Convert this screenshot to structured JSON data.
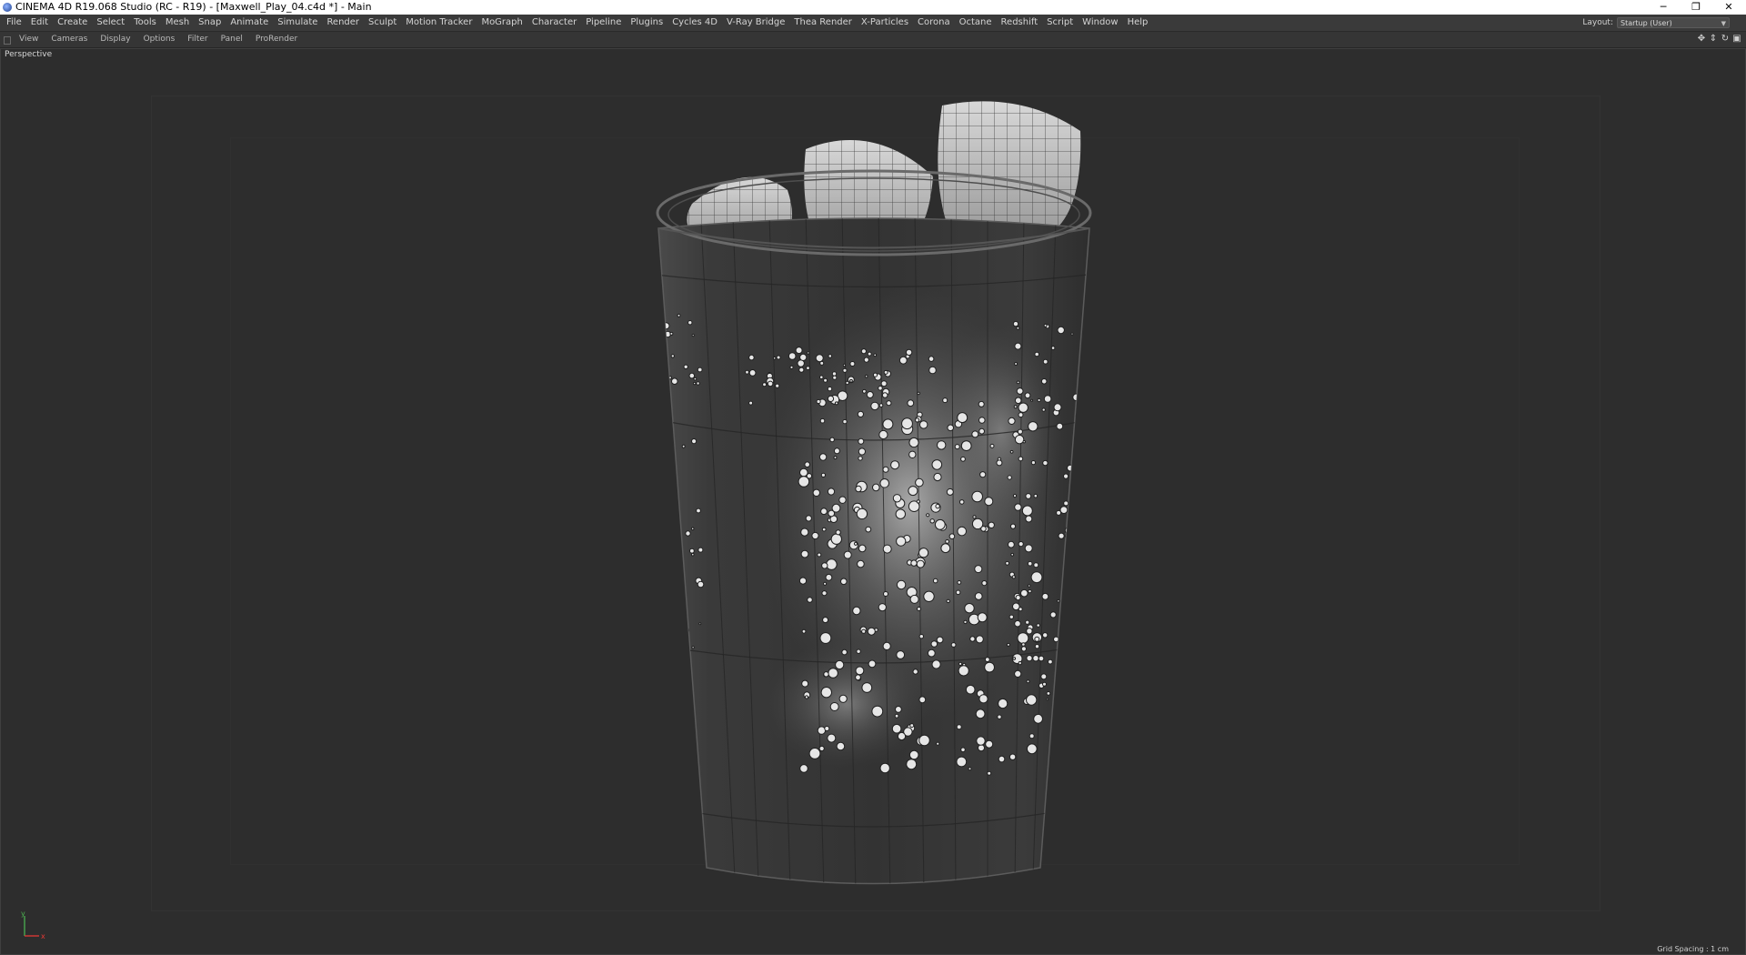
{
  "window": {
    "title": "CINEMA 4D R19.068 Studio (RC - R19) - [Maxwell_Play_04.c4d *] - Main",
    "controls": [
      "─",
      "❐",
      "✕"
    ]
  },
  "menu": {
    "items": [
      "File",
      "Edit",
      "Create",
      "Select",
      "Tools",
      "Mesh",
      "Snap",
      "Animate",
      "Simulate",
      "Render",
      "Sculpt",
      "Motion Tracker",
      "MoGraph",
      "Character",
      "Pipeline",
      "Plugins",
      "Cycles 4D",
      "V-Ray Bridge",
      "Thea Render",
      "X-Particles",
      "Corona",
      "Octane",
      "Redshift",
      "Script",
      "Window",
      "Help"
    ],
    "layout_label": "Layout:",
    "layout_value": "Startup (User)"
  },
  "viewport_menu": {
    "items": [
      "View",
      "Cameras",
      "Display",
      "Options",
      "Filter",
      "Panel",
      "ProRender"
    ],
    "icons": [
      "move-view-icon",
      "pan-view-icon",
      "rotate-view-icon",
      "maximize-view-icon"
    ],
    "icon_glyphs": [
      "✥",
      "⇕",
      "↻",
      "▣"
    ]
  },
  "viewport": {
    "label": "Perspective",
    "grid_spacing": "Grid Spacing : 1 cm",
    "axis": {
      "y": "y",
      "x": "x"
    }
  },
  "colors": {
    "background": "#2b2b2b",
    "axis_y": "#4caf50",
    "axis_x": "#e53935"
  }
}
